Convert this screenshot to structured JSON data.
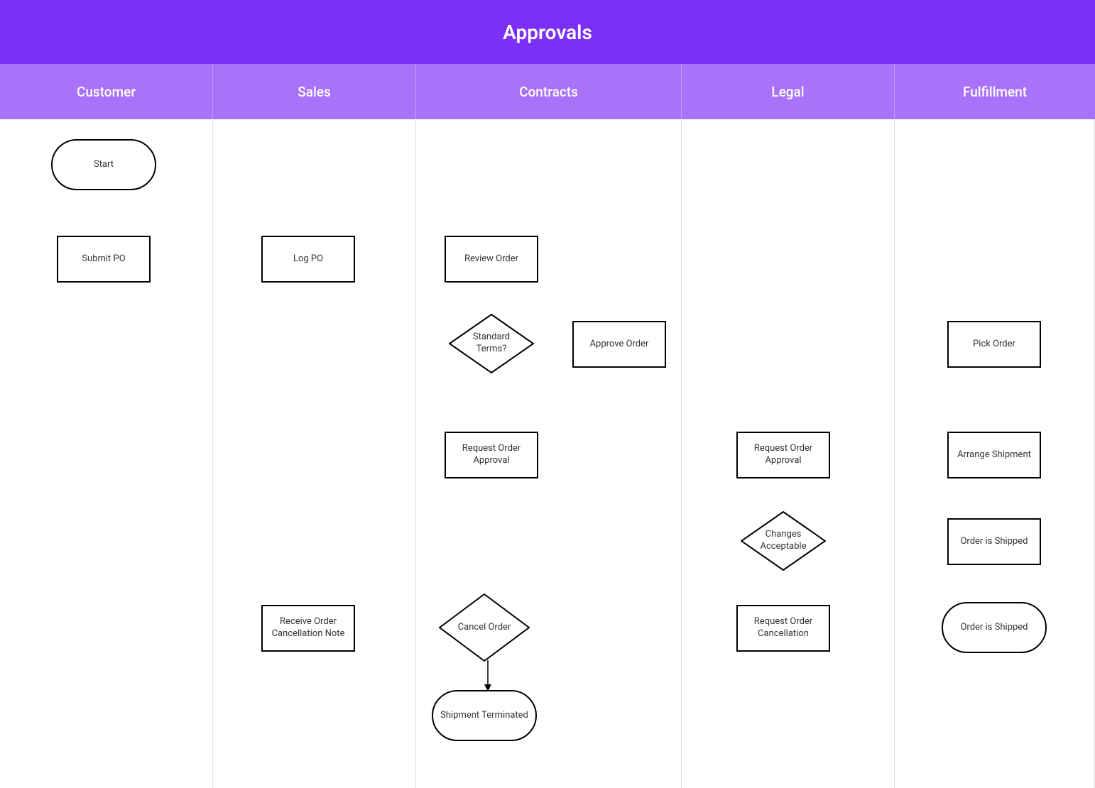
{
  "title": "Approvals",
  "lanes": {
    "customer": "Customer",
    "sales": "Sales",
    "contracts": "Contracts",
    "legal": "Legal",
    "fulfillment": "Fulfillment"
  },
  "nodes": {
    "start": "Start",
    "submitPO": "Submit PO",
    "logPO": "Log PO",
    "reviewOrder": "Review Order",
    "standardTerms": "Standard Terms?",
    "approveOrder": "Approve Order",
    "pickOrder": "Pick Order",
    "requestOrderApproval1": "Request Order Approval",
    "requestOrderApproval2": "Request Order Approval",
    "arrangeShipment": "Arrange Shipment",
    "changesAcceptable": "Changes Acceptable",
    "orderIsShipped1": "Order is Shipped",
    "receiveOrderCancellation": "Receive Order Cancellation Note",
    "cancelOrder": "Cancel Order",
    "requestOrderCancellation": "Request Order Cancellation",
    "orderIsShipped2": "Order is Shipped",
    "shipmentTerminated": "Shipment Terminated"
  }
}
